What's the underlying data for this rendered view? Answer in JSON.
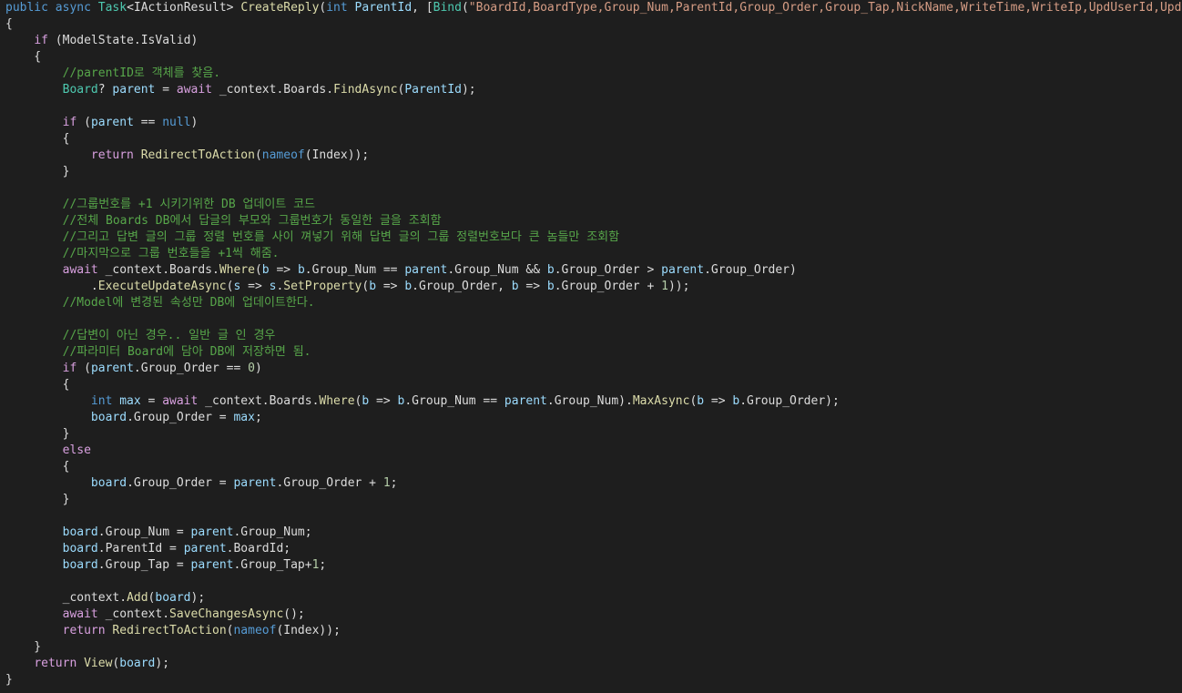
{
  "editor": {
    "lines": [
      [
        {
          "t": "public",
          "c": "kw"
        },
        {
          "t": " ",
          "c": "plain"
        },
        {
          "t": "async",
          "c": "kw"
        },
        {
          "t": " ",
          "c": "plain"
        },
        {
          "t": "Task",
          "c": "type"
        },
        {
          "t": "<IActionResult> ",
          "c": "plain"
        },
        {
          "t": "CreateReply",
          "c": "fn"
        },
        {
          "t": "(",
          "c": "plain"
        },
        {
          "t": "int",
          "c": "kw"
        },
        {
          "t": " ",
          "c": "plain"
        },
        {
          "t": "ParentId",
          "c": "param"
        },
        {
          "t": ", [",
          "c": "plain"
        },
        {
          "t": "Bind",
          "c": "type"
        },
        {
          "t": "(",
          "c": "plain"
        },
        {
          "t": "\"BoardId,BoardType,Group_Num,ParentId,Group_Order,Group_Tap,NickName,WriteTime,WriteIp,UpdUserId,UpdIp,Tit",
          "c": "str"
        }
      ],
      [
        {
          "t": "{",
          "c": "plain"
        }
      ],
      [
        {
          "t": "    ",
          "c": "plain"
        },
        {
          "t": "if",
          "c": "ctl"
        },
        {
          "t": " (ModelState.IsValid)",
          "c": "plain"
        }
      ],
      [
        {
          "t": "    {",
          "c": "plain"
        }
      ],
      [
        {
          "t": "        ",
          "c": "plain"
        },
        {
          "t": "//parentID로 객체를 찾음.",
          "c": "cm"
        }
      ],
      [
        {
          "t": "        ",
          "c": "plain"
        },
        {
          "t": "Board",
          "c": "type"
        },
        {
          "t": "? ",
          "c": "plain"
        },
        {
          "t": "parent",
          "c": "param"
        },
        {
          "t": " = ",
          "c": "plain"
        },
        {
          "t": "await",
          "c": "ctl"
        },
        {
          "t": " _context.Boards.",
          "c": "plain"
        },
        {
          "t": "FindAsync",
          "c": "fn"
        },
        {
          "t": "(",
          "c": "plain"
        },
        {
          "t": "ParentId",
          "c": "param"
        },
        {
          "t": ");",
          "c": "plain"
        }
      ],
      [],
      [
        {
          "t": "        ",
          "c": "plain"
        },
        {
          "t": "if",
          "c": "ctl"
        },
        {
          "t": " (",
          "c": "plain"
        },
        {
          "t": "parent",
          "c": "param"
        },
        {
          "t": " == ",
          "c": "plain"
        },
        {
          "t": "null",
          "c": "kw"
        },
        {
          "t": ")",
          "c": "plain"
        }
      ],
      [
        {
          "t": "        {",
          "c": "plain"
        }
      ],
      [
        {
          "t": "            ",
          "c": "plain"
        },
        {
          "t": "return",
          "c": "ctl"
        },
        {
          "t": " ",
          "c": "plain"
        },
        {
          "t": "RedirectToAction",
          "c": "fn"
        },
        {
          "t": "(",
          "c": "plain"
        },
        {
          "t": "nameof",
          "c": "kw"
        },
        {
          "t": "(Index));",
          "c": "plain"
        }
      ],
      [
        {
          "t": "        }",
          "c": "plain"
        }
      ],
      [],
      [
        {
          "t": "        ",
          "c": "plain"
        },
        {
          "t": "//그룹번호를 +1 시키기위한 DB 업데이트 코드",
          "c": "cm"
        }
      ],
      [
        {
          "t": "        ",
          "c": "plain"
        },
        {
          "t": "//전체 Boards DB에서 답글의 부모와 그룹번호가 동일한 글을 조회함",
          "c": "cm"
        }
      ],
      [
        {
          "t": "        ",
          "c": "plain"
        },
        {
          "t": "//그리고 답변 글의 그룹 정렬 번호를 사이 껴넣기 위해 답변 글의 그룹 정렬번호보다 큰 놈들만 조회함",
          "c": "cm"
        }
      ],
      [
        {
          "t": "        ",
          "c": "plain"
        },
        {
          "t": "//마지막으로 그룹 번호들을 +1씩 해줌.",
          "c": "cm"
        }
      ],
      [
        {
          "t": "        ",
          "c": "plain"
        },
        {
          "t": "await",
          "c": "ctl"
        },
        {
          "t": " _context.Boards.",
          "c": "plain"
        },
        {
          "t": "Where",
          "c": "fn"
        },
        {
          "t": "(",
          "c": "plain"
        },
        {
          "t": "b",
          "c": "param"
        },
        {
          "t": " => ",
          "c": "plain"
        },
        {
          "t": "b",
          "c": "param"
        },
        {
          "t": ".Group_Num == ",
          "c": "plain"
        },
        {
          "t": "parent",
          "c": "param"
        },
        {
          "t": ".Group_Num && ",
          "c": "plain"
        },
        {
          "t": "b",
          "c": "param"
        },
        {
          "t": ".Group_Order > ",
          "c": "plain"
        },
        {
          "t": "parent",
          "c": "param"
        },
        {
          "t": ".Group_Order)",
          "c": "plain"
        }
      ],
      [
        {
          "t": "            .",
          "c": "plain"
        },
        {
          "t": "ExecuteUpdateAsync",
          "c": "fn"
        },
        {
          "t": "(",
          "c": "plain"
        },
        {
          "t": "s",
          "c": "param"
        },
        {
          "t": " => ",
          "c": "plain"
        },
        {
          "t": "s",
          "c": "param"
        },
        {
          "t": ".",
          "c": "plain"
        },
        {
          "t": "SetProperty",
          "c": "fn"
        },
        {
          "t": "(",
          "c": "plain"
        },
        {
          "t": "b",
          "c": "param"
        },
        {
          "t": " => ",
          "c": "plain"
        },
        {
          "t": "b",
          "c": "param"
        },
        {
          "t": ".Group_Order, ",
          "c": "plain"
        },
        {
          "t": "b",
          "c": "param"
        },
        {
          "t": " => ",
          "c": "plain"
        },
        {
          "t": "b",
          "c": "param"
        },
        {
          "t": ".Group_Order + ",
          "c": "plain"
        },
        {
          "t": "1",
          "c": "num"
        },
        {
          "t": "));",
          "c": "plain"
        }
      ],
      [
        {
          "t": "        ",
          "c": "plain"
        },
        {
          "t": "//Model에 변경된 속성만 DB에 업데이트한다.",
          "c": "cm"
        }
      ],
      [],
      [
        {
          "t": "        ",
          "c": "plain"
        },
        {
          "t": "//답변이 아닌 경우.. 일반 글 인 경우",
          "c": "cm"
        }
      ],
      [
        {
          "t": "        ",
          "c": "plain"
        },
        {
          "t": "//파라미터 Board에 담아 DB에 저장하면 됨.",
          "c": "cm"
        }
      ],
      [
        {
          "t": "        ",
          "c": "plain"
        },
        {
          "t": "if",
          "c": "ctl"
        },
        {
          "t": " (",
          "c": "plain"
        },
        {
          "t": "parent",
          "c": "param"
        },
        {
          "t": ".Group_Order == ",
          "c": "plain"
        },
        {
          "t": "0",
          "c": "num"
        },
        {
          "t": ")",
          "c": "plain"
        }
      ],
      [
        {
          "t": "        {",
          "c": "plain"
        }
      ],
      [
        {
          "t": "            ",
          "c": "plain"
        },
        {
          "t": "int",
          "c": "kw"
        },
        {
          "t": " ",
          "c": "plain"
        },
        {
          "t": "max",
          "c": "param"
        },
        {
          "t": " = ",
          "c": "plain"
        },
        {
          "t": "await",
          "c": "ctl"
        },
        {
          "t": " _context.Boards.",
          "c": "plain"
        },
        {
          "t": "Where",
          "c": "fn"
        },
        {
          "t": "(",
          "c": "plain"
        },
        {
          "t": "b",
          "c": "param"
        },
        {
          "t": " => ",
          "c": "plain"
        },
        {
          "t": "b",
          "c": "param"
        },
        {
          "t": ".Group_Num == ",
          "c": "plain"
        },
        {
          "t": "parent",
          "c": "param"
        },
        {
          "t": ".Group_Num).",
          "c": "plain"
        },
        {
          "t": "MaxAsync",
          "c": "fn"
        },
        {
          "t": "(",
          "c": "plain"
        },
        {
          "t": "b",
          "c": "param"
        },
        {
          "t": " => ",
          "c": "plain"
        },
        {
          "t": "b",
          "c": "param"
        },
        {
          "t": ".Group_Order);",
          "c": "plain"
        }
      ],
      [
        {
          "t": "            ",
          "c": "plain"
        },
        {
          "t": "board",
          "c": "param"
        },
        {
          "t": ".Group_Order = ",
          "c": "plain"
        },
        {
          "t": "max",
          "c": "param"
        },
        {
          "t": ";",
          "c": "plain"
        }
      ],
      [
        {
          "t": "        }",
          "c": "plain"
        }
      ],
      [
        {
          "t": "        ",
          "c": "plain"
        },
        {
          "t": "else",
          "c": "ctl"
        }
      ],
      [
        {
          "t": "        {",
          "c": "plain"
        }
      ],
      [
        {
          "t": "            ",
          "c": "plain"
        },
        {
          "t": "board",
          "c": "param"
        },
        {
          "t": ".Group_Order = ",
          "c": "plain"
        },
        {
          "t": "parent",
          "c": "param"
        },
        {
          "t": ".Group_Order + ",
          "c": "plain"
        },
        {
          "t": "1",
          "c": "num"
        },
        {
          "t": ";",
          "c": "plain"
        }
      ],
      [
        {
          "t": "        }",
          "c": "plain"
        }
      ],
      [],
      [
        {
          "t": "        ",
          "c": "plain"
        },
        {
          "t": "board",
          "c": "param"
        },
        {
          "t": ".Group_Num = ",
          "c": "plain"
        },
        {
          "t": "parent",
          "c": "param"
        },
        {
          "t": ".Group_Num;",
          "c": "plain"
        }
      ],
      [
        {
          "t": "        ",
          "c": "plain"
        },
        {
          "t": "board",
          "c": "param"
        },
        {
          "t": ".ParentId = ",
          "c": "plain"
        },
        {
          "t": "parent",
          "c": "param"
        },
        {
          "t": ".BoardId;",
          "c": "plain"
        }
      ],
      [
        {
          "t": "        ",
          "c": "plain"
        },
        {
          "t": "board",
          "c": "param"
        },
        {
          "t": ".Group_Tap = ",
          "c": "plain"
        },
        {
          "t": "parent",
          "c": "param"
        },
        {
          "t": ".Group_Tap+",
          "c": "plain"
        },
        {
          "t": "1",
          "c": "num"
        },
        {
          "t": ";",
          "c": "plain"
        }
      ],
      [],
      [
        {
          "t": "        _context.",
          "c": "plain"
        },
        {
          "t": "Add",
          "c": "fn"
        },
        {
          "t": "(",
          "c": "plain"
        },
        {
          "t": "board",
          "c": "param"
        },
        {
          "t": ");",
          "c": "plain"
        }
      ],
      [
        {
          "t": "        ",
          "c": "plain"
        },
        {
          "t": "await",
          "c": "ctl"
        },
        {
          "t": " _context.",
          "c": "plain"
        },
        {
          "t": "SaveChangesAsync",
          "c": "fn"
        },
        {
          "t": "();",
          "c": "plain"
        }
      ],
      [
        {
          "t": "        ",
          "c": "plain"
        },
        {
          "t": "return",
          "c": "ctl"
        },
        {
          "t": " ",
          "c": "plain"
        },
        {
          "t": "RedirectToAction",
          "c": "fn"
        },
        {
          "t": "(",
          "c": "plain"
        },
        {
          "t": "nameof",
          "c": "kw"
        },
        {
          "t": "(Index));",
          "c": "plain"
        }
      ],
      [
        {
          "t": "    }",
          "c": "plain"
        }
      ],
      [
        {
          "t": "    ",
          "c": "plain"
        },
        {
          "t": "return",
          "c": "ctl"
        },
        {
          "t": " ",
          "c": "plain"
        },
        {
          "t": "View",
          "c": "fn"
        },
        {
          "t": "(",
          "c": "plain"
        },
        {
          "t": "board",
          "c": "param"
        },
        {
          "t": ");",
          "c": "plain"
        }
      ],
      [
        {
          "t": "}",
          "c": "plain"
        }
      ]
    ]
  }
}
